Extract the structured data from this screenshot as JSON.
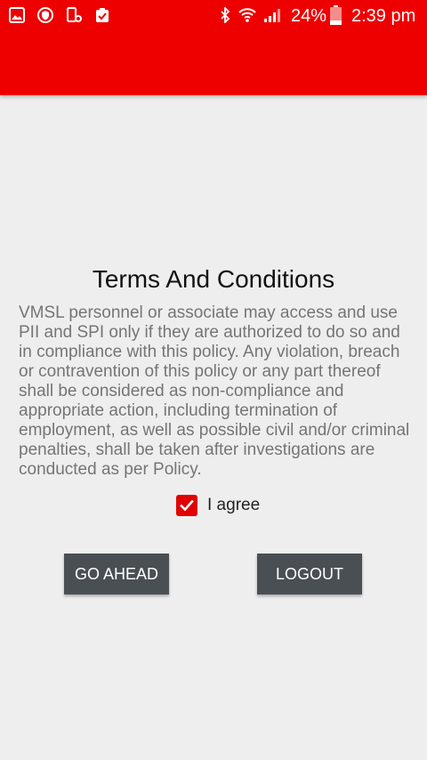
{
  "status_bar": {
    "icons_left": [
      "image-icon",
      "shield-icon",
      "device-icon",
      "clipboard-check-icon"
    ],
    "icons_right": [
      "bluetooth-icon",
      "wifi-icon",
      "signal-icon",
      "battery-icon"
    ],
    "battery": "24%",
    "time": "2:39 pm"
  },
  "colors": {
    "app_bar": "#ee0000",
    "accent": "#e00000",
    "button": "#4a4f54",
    "background": "#eeeeee"
  },
  "terms": {
    "title": "Terms And Conditions",
    "body": "VMSL personnel or associate may access and use PII and SPI only if they are authorized to do so and in compliance with this policy. Any violation, breach or contravention of this policy or any part thereof shall be considered as non-compliance and appropriate action, including termination of employment, as well as possible civil and/or criminal penalties, shall be taken after investigations are conducted as per Policy."
  },
  "agree": {
    "label": "I agree",
    "checked": true
  },
  "buttons": {
    "go_ahead": "GO AHEAD",
    "logout": "LOGOUT"
  }
}
